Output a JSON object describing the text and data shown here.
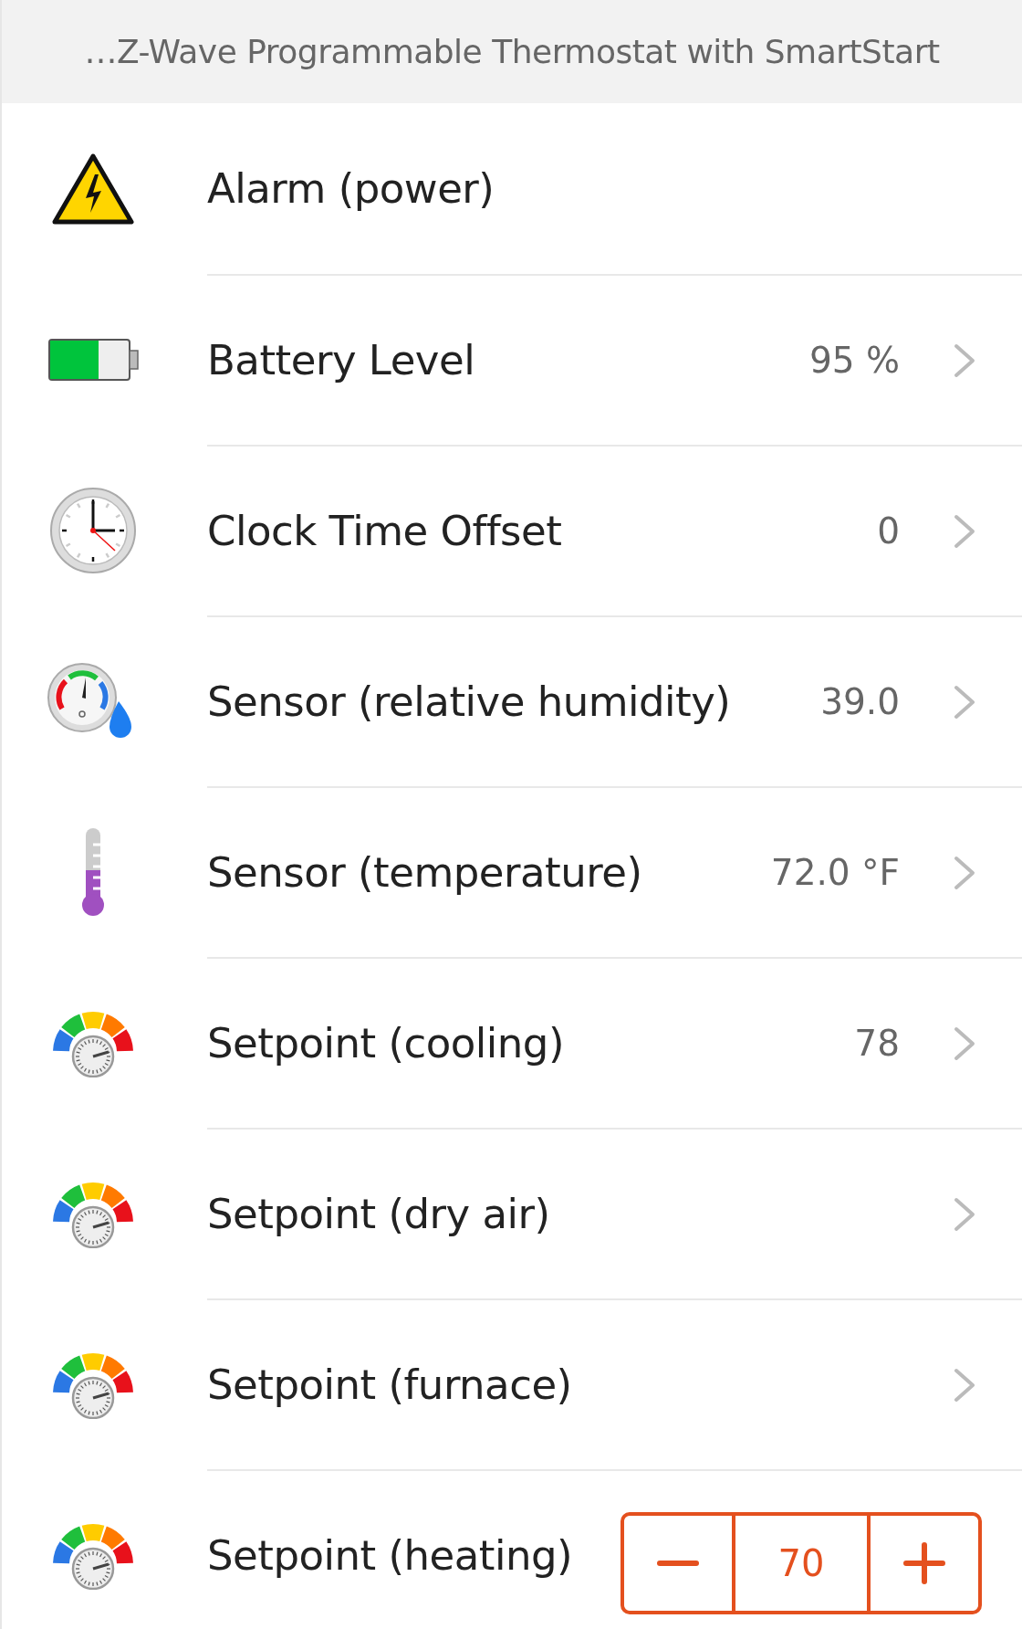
{
  "header": {
    "title": "…Z-Wave Programmable Thermostat with SmartStart"
  },
  "rows": [
    {
      "kind": "alarm",
      "label": "Alarm (power)",
      "navigable": false
    },
    {
      "kind": "battery",
      "label": "Battery Level",
      "value": "95 %",
      "navigable": true
    },
    {
      "kind": "clock",
      "label": "Clock Time Offset",
      "value": "0",
      "navigable": true
    },
    {
      "kind": "humidity",
      "label": "Sensor (relative humidity)",
      "value": "39.0",
      "navigable": true
    },
    {
      "kind": "temperature",
      "label": "Sensor (temperature)",
      "value": "72.0 °F",
      "navigable": true
    },
    {
      "kind": "setpoint",
      "label": "Setpoint (cooling)",
      "value": "78",
      "navigable": true
    },
    {
      "kind": "setpoint",
      "label": "Setpoint (dry air)",
      "navigable": true
    },
    {
      "kind": "setpoint",
      "label": "Setpoint (furnace)",
      "navigable": true
    },
    {
      "kind": "setpoint",
      "label": "Setpoint (heating)",
      "navigable": false,
      "stepper": {
        "value": "70"
      }
    }
  ]
}
